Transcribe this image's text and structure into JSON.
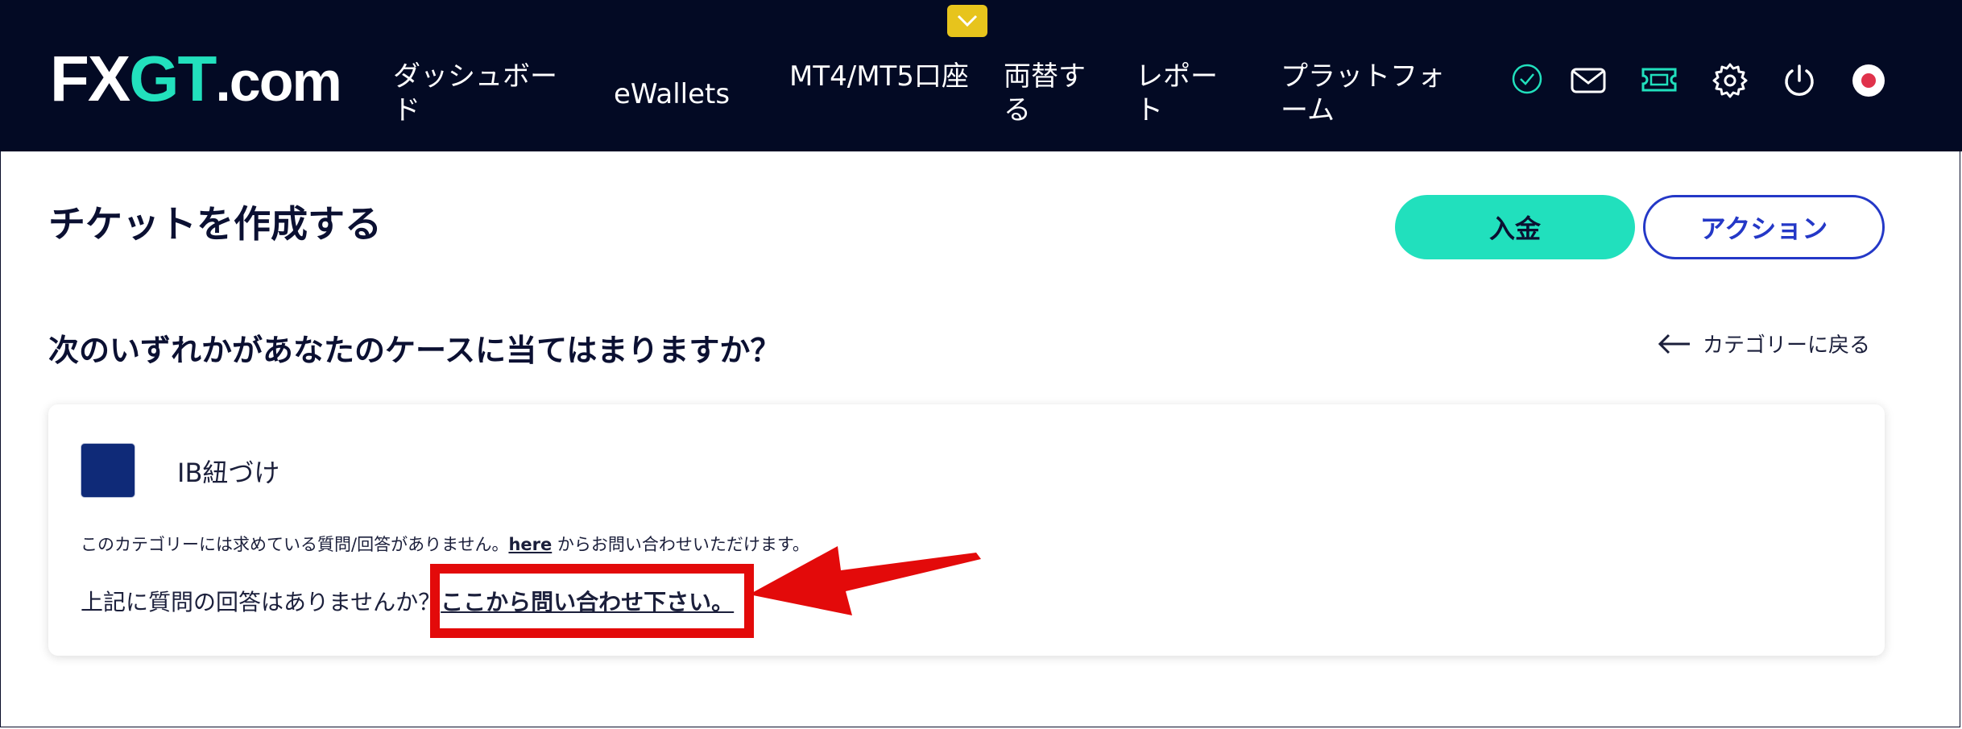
{
  "header": {
    "logo": {
      "fx": "FX",
      "gt": "GT",
      "com": ".com"
    },
    "nav": [
      {
        "label": "ダッシュボード"
      },
      {
        "label": "eWallets"
      },
      {
        "label": "MT4/MT5口座"
      },
      {
        "label": "両替する"
      },
      {
        "label": "レポート"
      },
      {
        "label": "プラットフォーム"
      }
    ],
    "icons": [
      "check-circle-icon",
      "mail-icon",
      "ticket-icon",
      "gear-icon",
      "power-icon",
      "flag-japan-icon"
    ]
  },
  "page": {
    "title": "チケットを作成する",
    "deposit_label": "入金",
    "action_label": "アクション",
    "question": "次のいずれかがあなたのケースに当てはまりますか？",
    "back_label": "カテゴリーに戻る"
  },
  "card": {
    "category_title": "IB紐づけ",
    "note_prefix": "このカテゴリーには求めている質問/回答がありません。",
    "note_link": "here",
    "note_suffix": " からお問い合わせいただけます。",
    "cta_prefix": "上記に質問の回答はありませんか？",
    "cta_link": "ここから問い合わせ下さい。"
  },
  "colors": {
    "header_bg": "#030a24",
    "brand_accent": "#21e0bd",
    "action_blue": "#2438c7",
    "annotation_red": "#e30a0a"
  }
}
